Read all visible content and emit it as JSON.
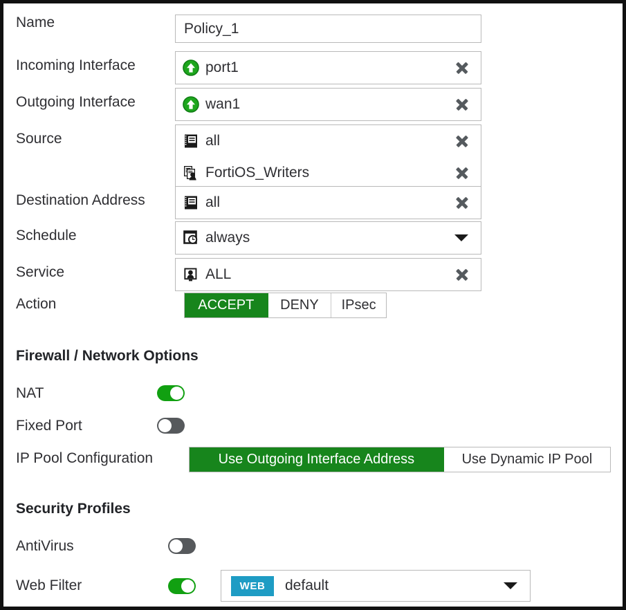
{
  "form": {
    "fields": [
      {
        "key": "name",
        "label": "Name",
        "type": "text",
        "value": "Policy_1"
      },
      {
        "key": "incoming_interface",
        "label": "Incoming Interface",
        "type": "tokens",
        "entries": [
          {
            "text": "port1",
            "icon": "interface-up-arrow-icon",
            "removable": "true"
          }
        ]
      },
      {
        "key": "outgoing_interface",
        "label": "Outgoing Interface",
        "type": "tokens",
        "entries": [
          {
            "text": "wan1",
            "icon": "interface-up-arrow-icon",
            "removable": "true"
          }
        ]
      },
      {
        "key": "source",
        "label": "Source",
        "type": "tokens",
        "entries": [
          {
            "text": "all",
            "icon": "address-book-icon",
            "removable": "true"
          },
          {
            "text": "FortiOS_Writers",
            "icon": "user-group-icon",
            "removable": "true"
          }
        ]
      },
      {
        "key": "destination_address",
        "label": "Destination Address",
        "type": "tokens",
        "entries": [
          {
            "text": "all",
            "icon": "address-book-icon",
            "removable": "true"
          }
        ]
      },
      {
        "key": "schedule",
        "label": "Schedule",
        "type": "dropdown",
        "entries": [
          {
            "text": "always",
            "icon": "schedule-clock-icon"
          }
        ]
      },
      {
        "key": "service",
        "label": "Service",
        "type": "tokens",
        "entries": [
          {
            "text": "ALL",
            "icon": "service-monitor-icon",
            "removable": "true"
          }
        ]
      },
      {
        "key": "action",
        "label": "Action",
        "type": "segmented",
        "options": [
          "ACCEPT",
          "DENY",
          "IPsec"
        ],
        "selected": "ACCEPT"
      }
    ]
  },
  "firewall_section": {
    "heading": "Firewall / Network Options",
    "nat": {
      "label": "NAT",
      "state": "on"
    },
    "fixed_port": {
      "label": "Fixed Port",
      "state": "off"
    },
    "ip_pool": {
      "label": "IP Pool Configuration",
      "options": [
        "Use Outgoing Interface Address",
        "Use Dynamic IP Pool"
      ],
      "selected": "Use Outgoing Interface Address"
    }
  },
  "security_section": {
    "heading": "Security Profiles",
    "antivirus": {
      "label": "AntiVirus",
      "state": "off"
    },
    "web_filter": {
      "label": "Web Filter",
      "state": "on",
      "badge": "WEB",
      "profile": "default"
    }
  },
  "colors": {
    "accent_green": "#17851c",
    "toggle_on": "#11a011",
    "toggle_off": "#56595c",
    "badge_blue": "#1e9cc4",
    "border": "#b9b9b9",
    "text": "#2f2f33"
  }
}
